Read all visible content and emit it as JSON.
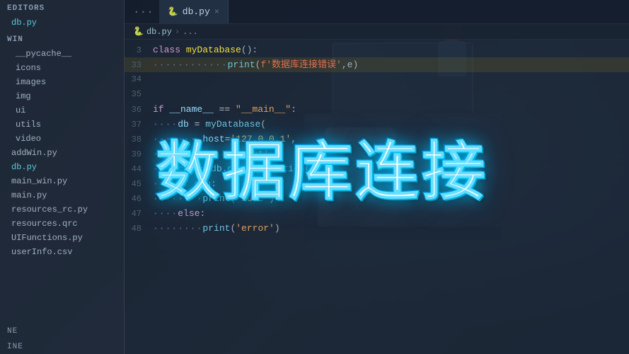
{
  "sidebar": {
    "editors_label": "EDITORS",
    "editors_files": [
      {
        "name": "db.py",
        "active": true
      }
    ],
    "win_label": "WIN",
    "win_dirs": [
      {
        "name": "__pycache__",
        "expanded": false
      },
      {
        "name": "icons",
        "expanded": false
      },
      {
        "name": "images",
        "expanded": false
      },
      {
        "name": "img",
        "expanded": false
      },
      {
        "name": "ui",
        "expanded": false
      },
      {
        "name": "utils",
        "expanded": false
      },
      {
        "name": "video",
        "expanded": false
      }
    ],
    "win_files": [
      "addWin.py",
      "db.py",
      "main_win.py",
      "main.py",
      "resources_rc.py",
      "resources.qrc",
      "UIFunctions.py",
      "userInfo.csv"
    ],
    "bottom_labels": [
      "NE",
      "INE"
    ]
  },
  "tab": {
    "dots": "···",
    "tab_icon": "🐍",
    "tab_name": "db.py",
    "close_icon": "×"
  },
  "breadcrumb": {
    "file": "db.py",
    "sep": ">",
    "path": "..."
  },
  "code": {
    "lines": [
      {
        "num": "3",
        "tokens": [
          [
            "kw",
            "class "
          ],
          [
            "cls",
            "myDatabase"
          ],
          [
            "punc",
            "():"
          ]
        ]
      },
      {
        "num": "33",
        "tokens": [
          [
            "dot",
            "············"
          ],
          [
            "fn",
            "print"
          ],
          [
            "punc",
            "("
          ],
          [
            "fstr",
            "f'数据库连接错误'"
          ],
          [
            "punc",
            ",e)"
          ]
        ],
        "highlight": true
      },
      {
        "num": "34",
        "tokens": []
      },
      {
        "num": "35",
        "tokens": []
      },
      {
        "num": "36",
        "tokens": [
          [
            "kw",
            "if "
          ],
          [
            "var",
            "__name__"
          ],
          [
            "op",
            " == "
          ],
          [
            "str",
            "\"__main__\""
          ],
          [
            "punc",
            ":"
          ]
        ]
      },
      {
        "num": "37",
        "tokens": [
          [
            "dot",
            "····"
          ],
          [
            "var",
            "db"
          ],
          [
            "op",
            " = "
          ],
          [
            "fn",
            "myDatabase"
          ],
          [
            "punc",
            "("
          ]
        ]
      },
      {
        "num": "38",
        "tokens": [
          [
            "dot",
            "········"
          ],
          [
            "var",
            "host"
          ],
          [
            "op",
            "="
          ],
          [
            "str",
            "'127.0.0.1'"
          ],
          [
            "punc",
            ","
          ]
        ]
      },
      {
        "num": "39",
        "tokens": [
          [
            "dot",
            "········"
          ],
          [
            "var",
            "con"
          ],
          [
            "op",
            " = "
          ],
          [
            "str",
            "'root'"
          ]
        ]
      },
      {
        "num": "44",
        "tokens": [
          [
            "dot",
            "····"
          ],
          [
            "var",
            "con"
          ],
          [
            "op",
            " = "
          ],
          [
            "var",
            "db"
          ],
          [
            "punc",
            "."
          ],
          [
            "fn",
            "get_connection"
          ],
          [
            "punc",
            "()"
          ]
        ]
      },
      {
        "num": "45",
        "tokens": [
          [
            "dot",
            "····"
          ],
          [
            "kw",
            "if "
          ],
          [
            "var",
            "con"
          ],
          [
            "punc",
            ":"
          ]
        ]
      },
      {
        "num": "46",
        "tokens": [
          [
            "dot",
            "········"
          ],
          [
            "fn",
            "print"
          ],
          [
            "punc",
            "("
          ],
          [
            "str",
            "'succ'"
          ],
          [
            "punc",
            ")"
          ]
        ]
      },
      {
        "num": "47",
        "tokens": [
          [
            "dot",
            "····"
          ],
          [
            "kw",
            "else"
          ],
          [
            "punc",
            ":"
          ]
        ]
      },
      {
        "num": "48",
        "tokens": [
          [
            "dot",
            "········"
          ],
          [
            "fn",
            "print"
          ],
          [
            "punc",
            "("
          ],
          [
            "str",
            "'error'"
          ],
          [
            "punc",
            ")"
          ]
        ]
      }
    ]
  },
  "title_overlay": {
    "text": "数据库连接"
  },
  "status_bar": {
    "left": "NE",
    "right": "INE"
  }
}
